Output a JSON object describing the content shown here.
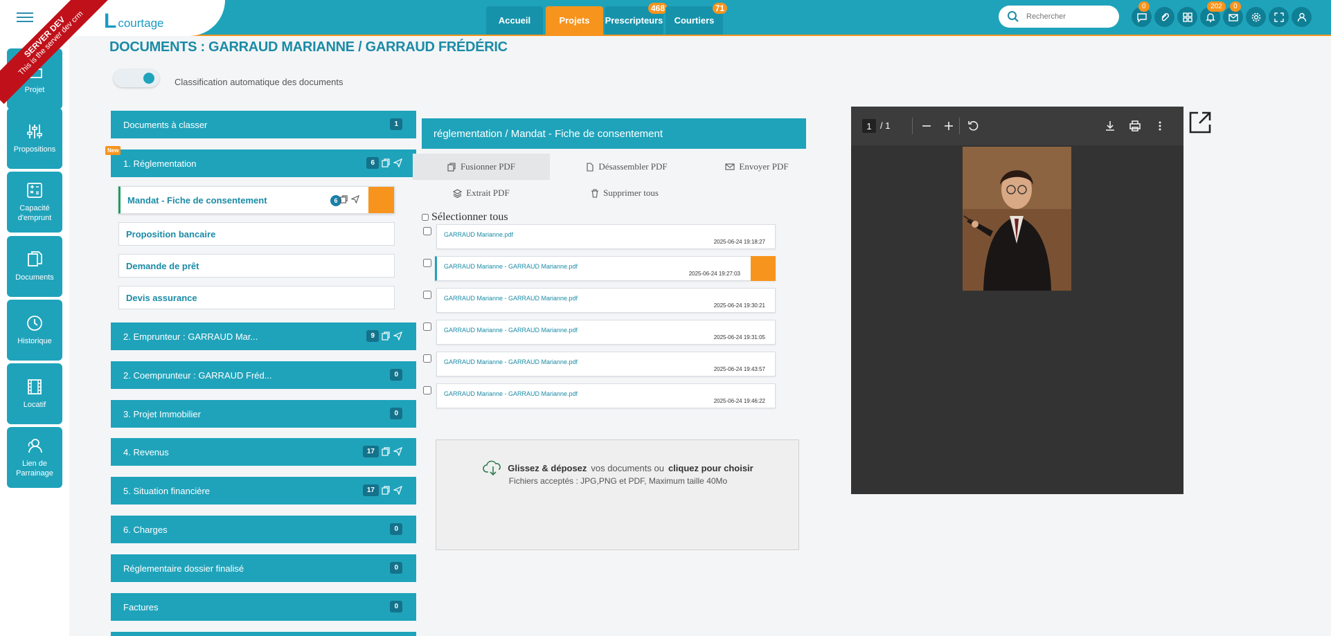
{
  "ribbon": {
    "line1": "SERVER DEV",
    "line2": "This is the server dev crm"
  },
  "logo": {
    "mark": "L",
    "text": "courtage"
  },
  "nav": {
    "tabs": [
      {
        "label": "Accueil",
        "badge": ""
      },
      {
        "label": "Projets",
        "badge": ""
      },
      {
        "label": "Prescripteurs",
        "badge": "468"
      },
      {
        "label": "Courtiers",
        "badge": "71"
      }
    ]
  },
  "search": {
    "placeholder": "Rechercher"
  },
  "header_icons": {
    "chat_badge": "0",
    "bell_badge": "202",
    "mail_badge": "0"
  },
  "sidebar": {
    "items": [
      {
        "label": "Projet"
      },
      {
        "label": "Propositions"
      },
      {
        "label": "Capacité d'emprunt"
      },
      {
        "label": "Documents"
      },
      {
        "label": "Historique"
      },
      {
        "label": "Locatif"
      },
      {
        "label": "Lien de Parrainage"
      }
    ]
  },
  "page": {
    "title": "DOCUMENTS : GARRAUD MARIANNE / GARRAUD FRÉDÉRIC",
    "toggle_label": "Classification automatique des documents",
    "new_tag": "New"
  },
  "categories": [
    {
      "label": "Documents à classer",
      "count": "1"
    },
    {
      "label": "1. Réglementation",
      "count": "6"
    },
    {
      "label": "2. Emprunteur : GARRAUD Mar...",
      "count": "9"
    },
    {
      "label": "2. Coemprunteur : GARRAUD Fréd...",
      "count": "0"
    },
    {
      "label": "3. Projet Immobilier",
      "count": "0"
    },
    {
      "label": "4. Revenus",
      "count": "17"
    },
    {
      "label": "5. Situation financière",
      "count": "17"
    },
    {
      "label": "6. Charges",
      "count": "0"
    },
    {
      "label": "Réglementaire dossier finalisé",
      "count": "0"
    },
    {
      "label": "Factures",
      "count": "0"
    }
  ],
  "subcategories": [
    {
      "label": "Mandat - Fiche de consentement",
      "count": "6"
    },
    {
      "label": "Proposition bancaire"
    },
    {
      "label": "Demande de prêt"
    },
    {
      "label": "Devis assurance"
    }
  ],
  "panel": {
    "title": "réglementation / Mandat - Fiche de consentement",
    "tools": {
      "fusion": "Fusionner PDF",
      "desassembler": "Désassembler PDF",
      "envoyer": "Envoyer PDF",
      "extrait": "Extrait PDF",
      "supprimer": "Supprimer tous"
    },
    "select_all": "Sélectionner tous",
    "files": [
      {
        "name": "GARRAUD Marianne.pdf",
        "date": "2025-06-24 19:18:27"
      },
      {
        "name": "GARRAUD Marianne - GARRAUD Marianne.pdf",
        "date": "2025-06-24 19:27:03"
      },
      {
        "name": "GARRAUD Marianne - GARRAUD Marianne.pdf",
        "date": "2025-06-24 19:30:21"
      },
      {
        "name": "GARRAUD Marianne - GARRAUD Marianne.pdf",
        "date": "2025-06-24 19:31:05"
      },
      {
        "name": "GARRAUD Marianne - GARRAUD Marianne.pdf",
        "date": "2025-06-24 19:43:57"
      },
      {
        "name": "GARRAUD Marianne - GARRAUD Marianne.pdf",
        "date": "2025-06-24 19:46:22"
      }
    ],
    "dropzone": {
      "bold1": "Glissez & déposez",
      "mid": "vos documents ou",
      "bold2": "cliquez pour choisir",
      "accepted": "Fichiers acceptés : JPG,PNG et PDF, Maximum taille 40Mo"
    }
  },
  "viewer": {
    "page": "1",
    "total": "/ 1"
  },
  "colors": {
    "primary": "#1fa3bb",
    "accent": "#f7941d",
    "dark_viewer": "#333333"
  }
}
